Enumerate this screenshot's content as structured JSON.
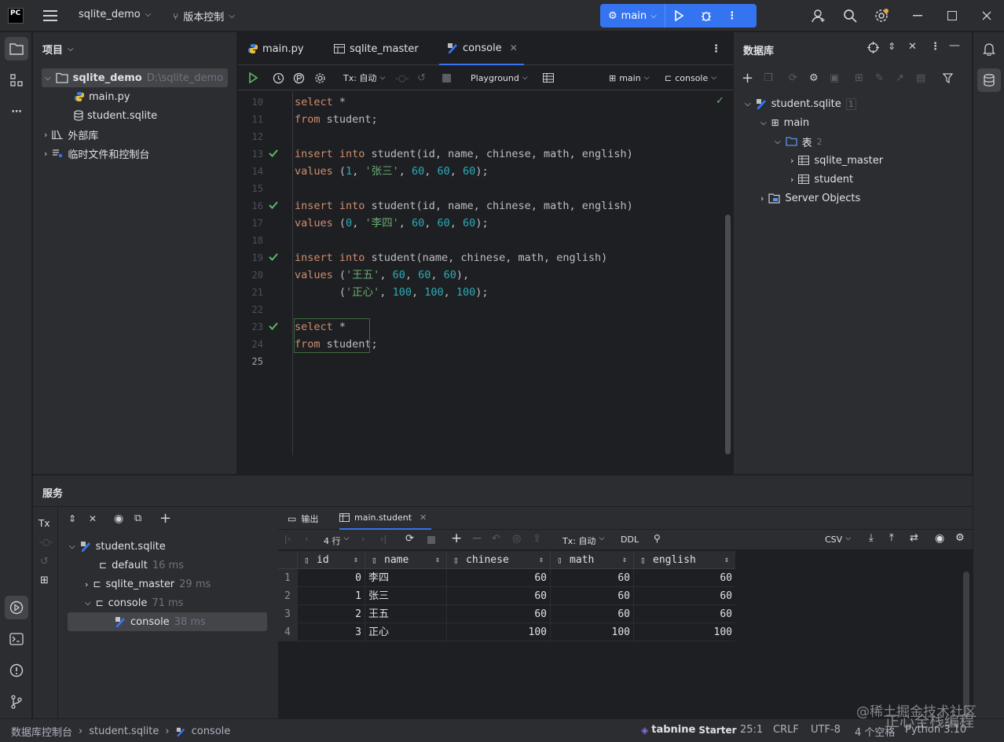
{
  "titlebar": {
    "logo": "PC",
    "project_name": "sqlite_demo",
    "vcs_label": "版本控制",
    "run_config": "main"
  },
  "project_panel": {
    "title": "项目",
    "root_name": "sqlite_demo",
    "root_path": "D:\\sqlite_demo",
    "files": [
      "main.py",
      "student.sqlite"
    ],
    "external_libs": "外部库",
    "scratches": "临时文件和控制台"
  },
  "editor": {
    "tabs": [
      "main.py",
      "sqlite_master",
      "console"
    ],
    "active_tab": "console",
    "toolbar": {
      "tx_label": "Tx: 自动",
      "playground_label": "Playground",
      "schema_label": "main",
      "session_label": "console"
    },
    "line_numbers": [
      "10",
      "11",
      "12",
      "13",
      "14",
      "15",
      "16",
      "17",
      "18",
      "19",
      "20",
      "21",
      "22",
      "23",
      "24",
      "25"
    ],
    "code_lines": [
      [
        [
          "kw",
          "select "
        ],
        [
          "plain",
          "*"
        ]
      ],
      [
        [
          "kw",
          "from "
        ],
        [
          "plain",
          "student;"
        ]
      ],
      [],
      [
        [
          "kw",
          "insert into "
        ],
        [
          "plain",
          "student(id, name, chinese, math, english)"
        ]
      ],
      [
        [
          "kw",
          "values "
        ],
        [
          "plain",
          "("
        ],
        [
          "num",
          "1"
        ],
        [
          "plain",
          ", "
        ],
        [
          "str",
          "'张三'"
        ],
        [
          "plain",
          ", "
        ],
        [
          "num",
          "60"
        ],
        [
          "plain",
          ", "
        ],
        [
          "num",
          "60"
        ],
        [
          "plain",
          ", "
        ],
        [
          "num",
          "60"
        ],
        [
          "plain",
          ");"
        ]
      ],
      [],
      [
        [
          "kw",
          "insert into "
        ],
        [
          "plain",
          "student(id, name, chinese, math, english)"
        ]
      ],
      [
        [
          "kw",
          "values "
        ],
        [
          "plain",
          "("
        ],
        [
          "num",
          "0"
        ],
        [
          "plain",
          ", "
        ],
        [
          "str",
          "'李四'"
        ],
        [
          "plain",
          ", "
        ],
        [
          "num",
          "60"
        ],
        [
          "plain",
          ", "
        ],
        [
          "num",
          "60"
        ],
        [
          "plain",
          ", "
        ],
        [
          "num",
          "60"
        ],
        [
          "plain",
          ");"
        ]
      ],
      [],
      [
        [
          "kw",
          "insert into "
        ],
        [
          "plain",
          "student(name, chinese, math, english)"
        ]
      ],
      [
        [
          "kw",
          "values "
        ],
        [
          "plain",
          "("
        ],
        [
          "str",
          "'王五'"
        ],
        [
          "plain",
          ", "
        ],
        [
          "num",
          "60"
        ],
        [
          "plain",
          ", "
        ],
        [
          "num",
          "60"
        ],
        [
          "plain",
          ", "
        ],
        [
          "num",
          "60"
        ],
        [
          "plain",
          "),"
        ]
      ],
      [
        [
          "plain",
          "       ("
        ],
        [
          "str",
          "'正心'"
        ],
        [
          "plain",
          ", "
        ],
        [
          "num",
          "100"
        ],
        [
          "plain",
          ", "
        ],
        [
          "num",
          "100"
        ],
        [
          "plain",
          ", "
        ],
        [
          "num",
          "100"
        ],
        [
          "plain",
          ");"
        ]
      ],
      [],
      [
        [
          "kw",
          "select "
        ],
        [
          "plain",
          "*"
        ]
      ],
      [
        [
          "kw",
          "from "
        ],
        [
          "plain",
          "student;"
        ]
      ],
      []
    ]
  },
  "database_panel": {
    "title": "数据库",
    "datasource": "student.sqlite",
    "datasource_count": "1",
    "schema": "main",
    "tables_label": "表",
    "tables_count": "2",
    "tables": [
      "sqlite_master",
      "student"
    ],
    "server_objects": "Server Objects"
  },
  "services": {
    "title": "服务",
    "tree": {
      "root": "student.sqlite",
      "default_label": "default",
      "default_time": "16 ms",
      "sqlite_master_label": "sqlite_master",
      "sqlite_master_time": "29 ms",
      "console_group_label": "console",
      "console_group_time": "71 ms",
      "console_label": "console",
      "console_time": "38 ms"
    },
    "tabs": [
      "输出",
      "main.student"
    ],
    "grid_toolbar": {
      "rows_label": "4 行",
      "tx_label": "Tx: 自动",
      "ddl_label": "DDL",
      "export_label": "CSV"
    },
    "columns": [
      "id",
      "name",
      "chinese",
      "math",
      "english"
    ],
    "rows": [
      [
        "1",
        "0",
        "李四",
        "60",
        "60",
        "60"
      ],
      [
        "2",
        "1",
        "张三",
        "60",
        "60",
        "60"
      ],
      [
        "3",
        "2",
        "王五",
        "60",
        "60",
        "60"
      ],
      [
        "4",
        "3",
        "正心",
        "100",
        "100",
        "100"
      ]
    ]
  },
  "statusbar": {
    "breadcrumb": [
      "数据库控制台",
      "student.sqlite",
      "console"
    ],
    "tabnine_brand": "tabnine",
    "tabnine_plan": "Starter",
    "position": "25:1",
    "line_sep": "CRLF",
    "encoding": "UTF-8",
    "indent": "4 个空格",
    "interpreter": "Python 3.10"
  },
  "watermark": "@稀土掘金技术社区",
  "watermark2": "正心全栈编程"
}
